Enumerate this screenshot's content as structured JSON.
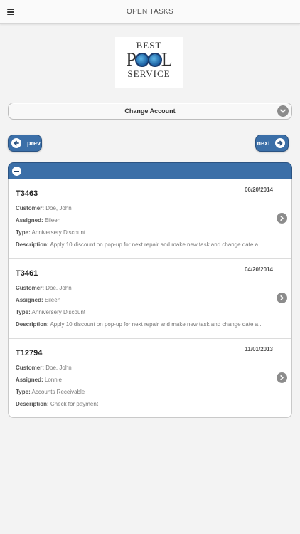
{
  "header": {
    "title": "OPEN TASKS"
  },
  "logo": {
    "top": "BEST",
    "pool_p": "P",
    "pool_l": "L",
    "bottom": "SERVICE"
  },
  "account_select": {
    "label": "Change Account"
  },
  "nav": {
    "prev_label": "prev",
    "next_label": "next"
  },
  "labels": {
    "customer": "Customer:",
    "assigned": "Assigned:",
    "type": "Type:",
    "description": "Description:"
  },
  "tasks": [
    {
      "id": "T3463",
      "date": "06/20/2014",
      "customer": "Doe, John",
      "assigned": "Eileen",
      "type": "Anniversery Discount",
      "description": "Apply 10 discount on pop-up for next repair and make new task and change date a..."
    },
    {
      "id": "T3461",
      "date": "04/20/2014",
      "customer": "Doe, John",
      "assigned": "Eileen",
      "type": "Anniversery Discount",
      "description": "Apply 10 discount on pop-up for next repair and make new task and change date a..."
    },
    {
      "id": "T12794",
      "date": "11/01/2013",
      "customer": "Doe, John",
      "assigned": "Lonnie",
      "type": "Accounts Receivable",
      "description": "Check for payment"
    }
  ],
  "colors": {
    "accent": "#3b6fa8",
    "accent_border": "#2b5382",
    "chevron": "#8c8c8c"
  }
}
